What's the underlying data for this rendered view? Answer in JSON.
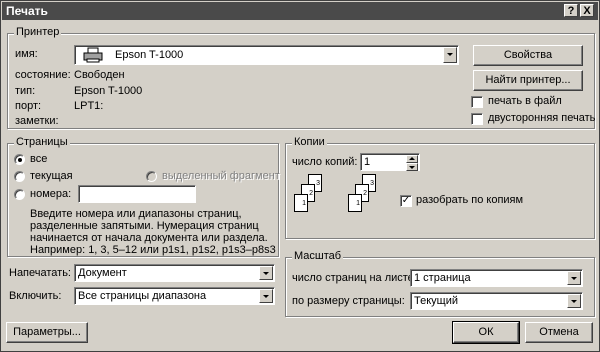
{
  "window": {
    "title": "Печать",
    "help_btn": "?",
    "close_btn": "X"
  },
  "printer": {
    "legend": "Принтер",
    "name_label": "имя:",
    "name_value": "Epson T-1000",
    "state_label": "состояние:",
    "state_value": "Свободен",
    "type_label": "тип:",
    "type_value": "Epson T-1000",
    "port_label": "порт:",
    "port_value": "LPT1:",
    "notes_label": "заметки:",
    "properties_btn": "Свойства",
    "find_btn": "Найти принтер...",
    "print_to_file": "печать в файл",
    "duplex": "двусторонняя печать"
  },
  "pages": {
    "legend": "Страницы",
    "all": "все",
    "current": "текущая",
    "selection": "выделенный фрагмент",
    "numbers": "номера:",
    "numbers_value": "",
    "hint_lines": [
      "Введите номера или диапазоны страниц,",
      "разделенные запятыми. Нумерация страниц",
      "начинается от начала документа или раздела.",
      "Например: 1, 3, 5–12 или p1s1, p1s2, p1s3–p8s3"
    ]
  },
  "copies": {
    "legend": "Копии",
    "count_label": "число копий:",
    "count_value": "1",
    "collate": "разобрать по копиям",
    "page_labels": [
      "1",
      "2",
      "3"
    ]
  },
  "print_what": {
    "label": "Напечатать:",
    "value": "Документ"
  },
  "include": {
    "label": "Включить:",
    "value": "Все страницы диапазона"
  },
  "zoom": {
    "legend": "Масштаб",
    "pages_per_sheet_label": "число страниц на листе:",
    "pages_per_sheet_value": "1 страница",
    "scale_label": "по размеру страницы:",
    "scale_value": "Текущий"
  },
  "footer": {
    "options_btn": "Параметры...",
    "ok_btn": "ОК",
    "cancel_btn": "Отмена"
  }
}
